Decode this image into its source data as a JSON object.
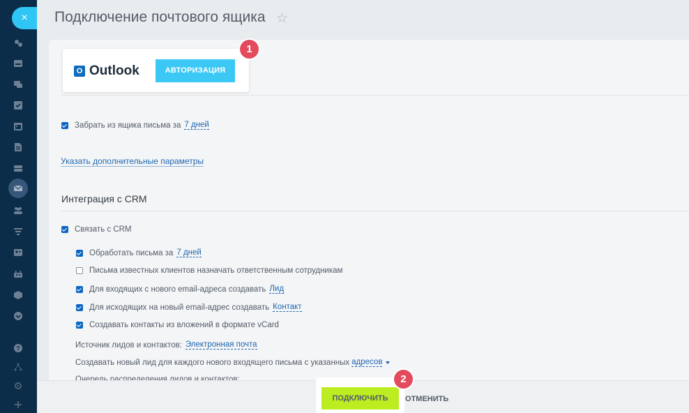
{
  "header": {
    "title": "Подключение почтового ящика"
  },
  "sidebar": {
    "close_symbol": "×",
    "icons": [
      "activity-icon",
      "inbox-icon",
      "chat-icon",
      "tasks-icon",
      "calendar-icon",
      "document-icon",
      "drive-icon",
      "mail-icon",
      "team-icon",
      "filter-icon",
      "contact-card-icon",
      "robot-icon",
      "box-icon",
      "chevron-down-icon",
      "help-icon",
      "sitemap-icon",
      "settings-icon",
      "plus-icon"
    ]
  },
  "outlook": {
    "logo_letter": "O",
    "name": "Outlook",
    "auth_label": "АВТОРИЗАЦИЯ",
    "badge": "1"
  },
  "fetch": {
    "label": "Забрать из ящика письма за",
    "period": "7 дней"
  },
  "extra_params_link": "Указать дополнительные параметры",
  "crm": {
    "section_title": "Интеграция с CRM",
    "link_label": "Связать с CRM",
    "process_label": "Обработать письма за",
    "process_period": "7 дней",
    "known_clients_label": "Письма известных клиентов назначать ответственным сотрудникам",
    "incoming_label": "Для входящих с нового email-адреса создавать",
    "incoming_value": "Лид",
    "outgoing_label": "Для исходящих на новый email-адрес создавать",
    "outgoing_value": "Контакт",
    "vcard_label": "Создавать контакты из вложений в формате vCard",
    "source_label": "Источник лидов и контактов:",
    "source_value": "Электронная почта",
    "new_lead_label": "Создавать новый лид для каждого нового входящего письма с указанных",
    "new_lead_value": "адресов",
    "queue_label": "Очередь распределения лидов и контактов:"
  },
  "footer": {
    "connect_label": "ПОДКЛЮЧИТЬ",
    "cancel_label": "ОТМЕНИТЬ",
    "badge": "2"
  },
  "colors": {
    "sidebar": "#0b2d4a",
    "accent": "#2fc6f6",
    "connect": "#bbed21",
    "badge": "#e34b5c",
    "link": "#2067b0"
  }
}
